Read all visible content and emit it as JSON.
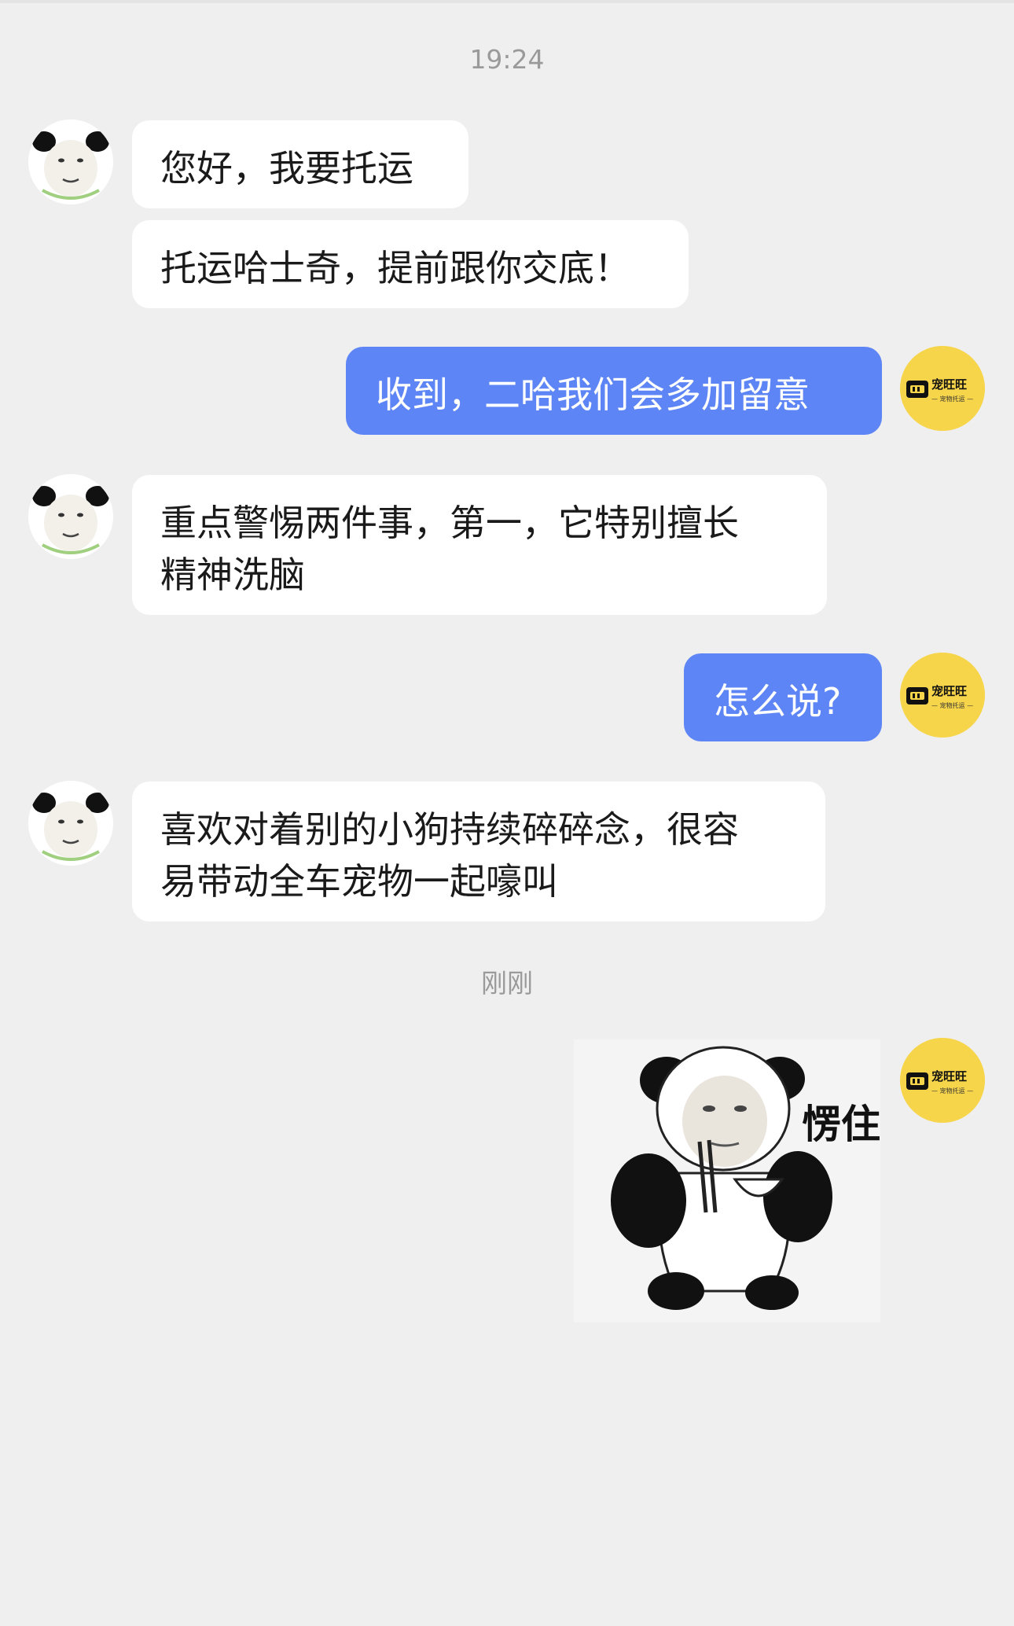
{
  "chat": {
    "timestamp_1": "19:24",
    "timestamp_2": "刚刚",
    "messages": [
      {
        "side": "in",
        "text": "您好，我要托运"
      },
      {
        "side": "in",
        "text": "托运哈士奇，提前跟你交底！"
      },
      {
        "side": "out",
        "text": "收到，二哈我们会多加留意"
      },
      {
        "side": "in",
        "text": "重点警惕两件事，第一，它特别擅长\n精神洗脑"
      },
      {
        "side": "out",
        "text": "怎么说?"
      },
      {
        "side": "in",
        "text": "喜欢对着别的小狗持续碎碎念，很容\n易带动全车宠物一起嚎叫"
      }
    ],
    "sticker": {
      "caption": "愣住",
      "icon": "panda-meme-sticker"
    }
  },
  "brand": {
    "name": "宠旺旺",
    "tagline": "— 宠物托运 —",
    "color": "#f7d54a"
  },
  "colors": {
    "background": "#efefef",
    "outgoing_bubble": "#5e85f5",
    "incoming_bubble": "#ffffff"
  }
}
